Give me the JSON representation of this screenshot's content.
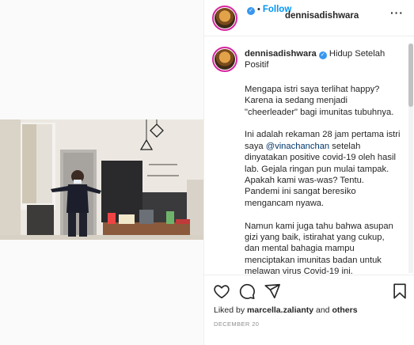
{
  "author": {
    "username": "dennisadishwara",
    "verified_icon": "verified-badge-icon",
    "separator": "•",
    "follow_label": "Follow",
    "more_label": "···"
  },
  "caption": {
    "username": "dennisadishwara",
    "title": "Hidup Setelah Positif",
    "paragraph1": "Mengapa istri saya terlihat happy? Karena ia sedang menjadi \"cheerleader\" bagi imunitas tubuhnya.",
    "paragraph2_before": "Ini adalah rekaman 28 jam pertama istri saya ",
    "paragraph2_mention": "@vinachanchan",
    "paragraph2_after": " setelah dinyatakan positive covid-19 oleh hasil lab. Gejala ringan pun mulai tampak. Apakah kami was-was? Tentu. Pandemi ini sangat beresiko mengancam nyawa.",
    "paragraph3": "Namun kami juga tahu bahwa asupan gizi yang baik, istirahat yang cukup, dan mental bahagia mampu menciptakan imunitas badan untuk melawan virus Covid-19 ini."
  },
  "actions": {
    "like_icon": "heart-icon",
    "comment_icon": "comment-icon",
    "share_icon": "paper-plane-icon",
    "save_icon": "bookmark-icon"
  },
  "likes": {
    "prefix": "Liked by ",
    "user": "marcella.zalianty",
    "middle": " and ",
    "others": "others"
  },
  "date": "DECEMBER 20",
  "colors": {
    "accent": "#0095f6",
    "verified": "#3897f0",
    "mention": "#00376b",
    "muted": "#8e8e8e"
  }
}
